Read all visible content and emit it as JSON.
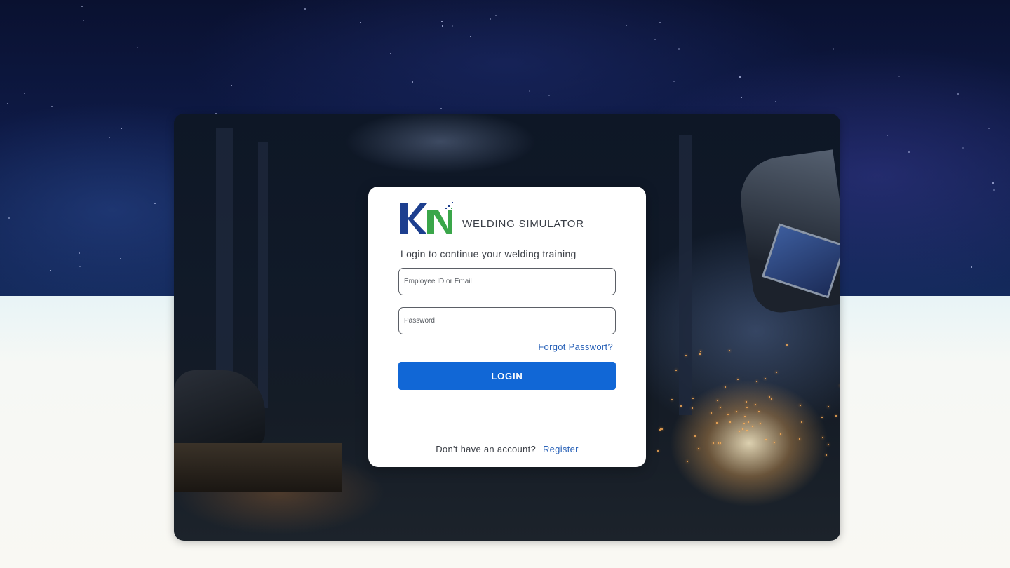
{
  "colors": {
    "primary_button": "#1167d6",
    "link": "#2b63b8",
    "logo_blue": "#1d3f8f",
    "logo_green": "#3aa64a"
  },
  "icons": {
    "logo": "kn-logo-icon"
  },
  "login": {
    "brand_name": "WELDING SIMULATOR",
    "subtitle": "Login to continue your welding training",
    "email_placeholder": "Employee ID or Email",
    "email_value": "",
    "password_placeholder": "Password",
    "password_value": "",
    "forgot_password_label": "Forgot Passwort?",
    "login_button_label": "LOGIN",
    "register_prompt": "Don't have an account?",
    "register_label": "Register"
  }
}
